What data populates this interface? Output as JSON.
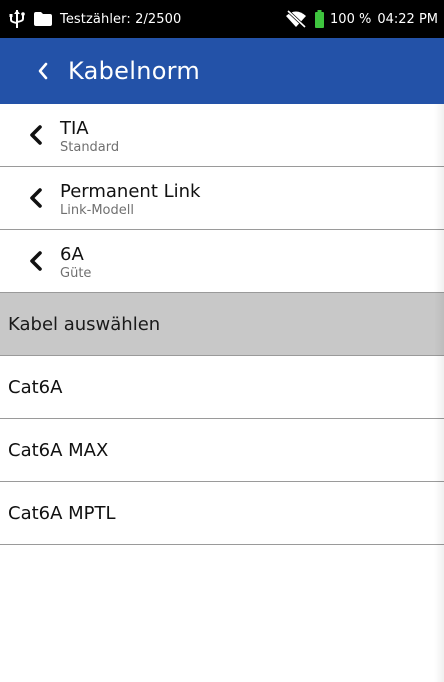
{
  "status_bar": {
    "usb_icon": "usb-icon",
    "folder_icon": "folder-icon",
    "counter_text": "Testzähler: 2/2500",
    "wifi_icon": "wifi-off-icon",
    "battery_icon": "battery-icon",
    "battery_text": "100 %",
    "time": "04:22 PM"
  },
  "app_bar": {
    "back_icon": "chevron-left-icon",
    "title": "Kabelnorm",
    "color": "#2352a8"
  },
  "selections": [
    {
      "value": "TIA",
      "label": "Standard"
    },
    {
      "value": "Permanent Link",
      "label": "Link-Modell"
    },
    {
      "value": "6A",
      "label": "Güte"
    }
  ],
  "section_header": "Kabel auswählen",
  "cable_options": [
    "Cat6A",
    "Cat6A MAX",
    "Cat6A MPTL"
  ]
}
